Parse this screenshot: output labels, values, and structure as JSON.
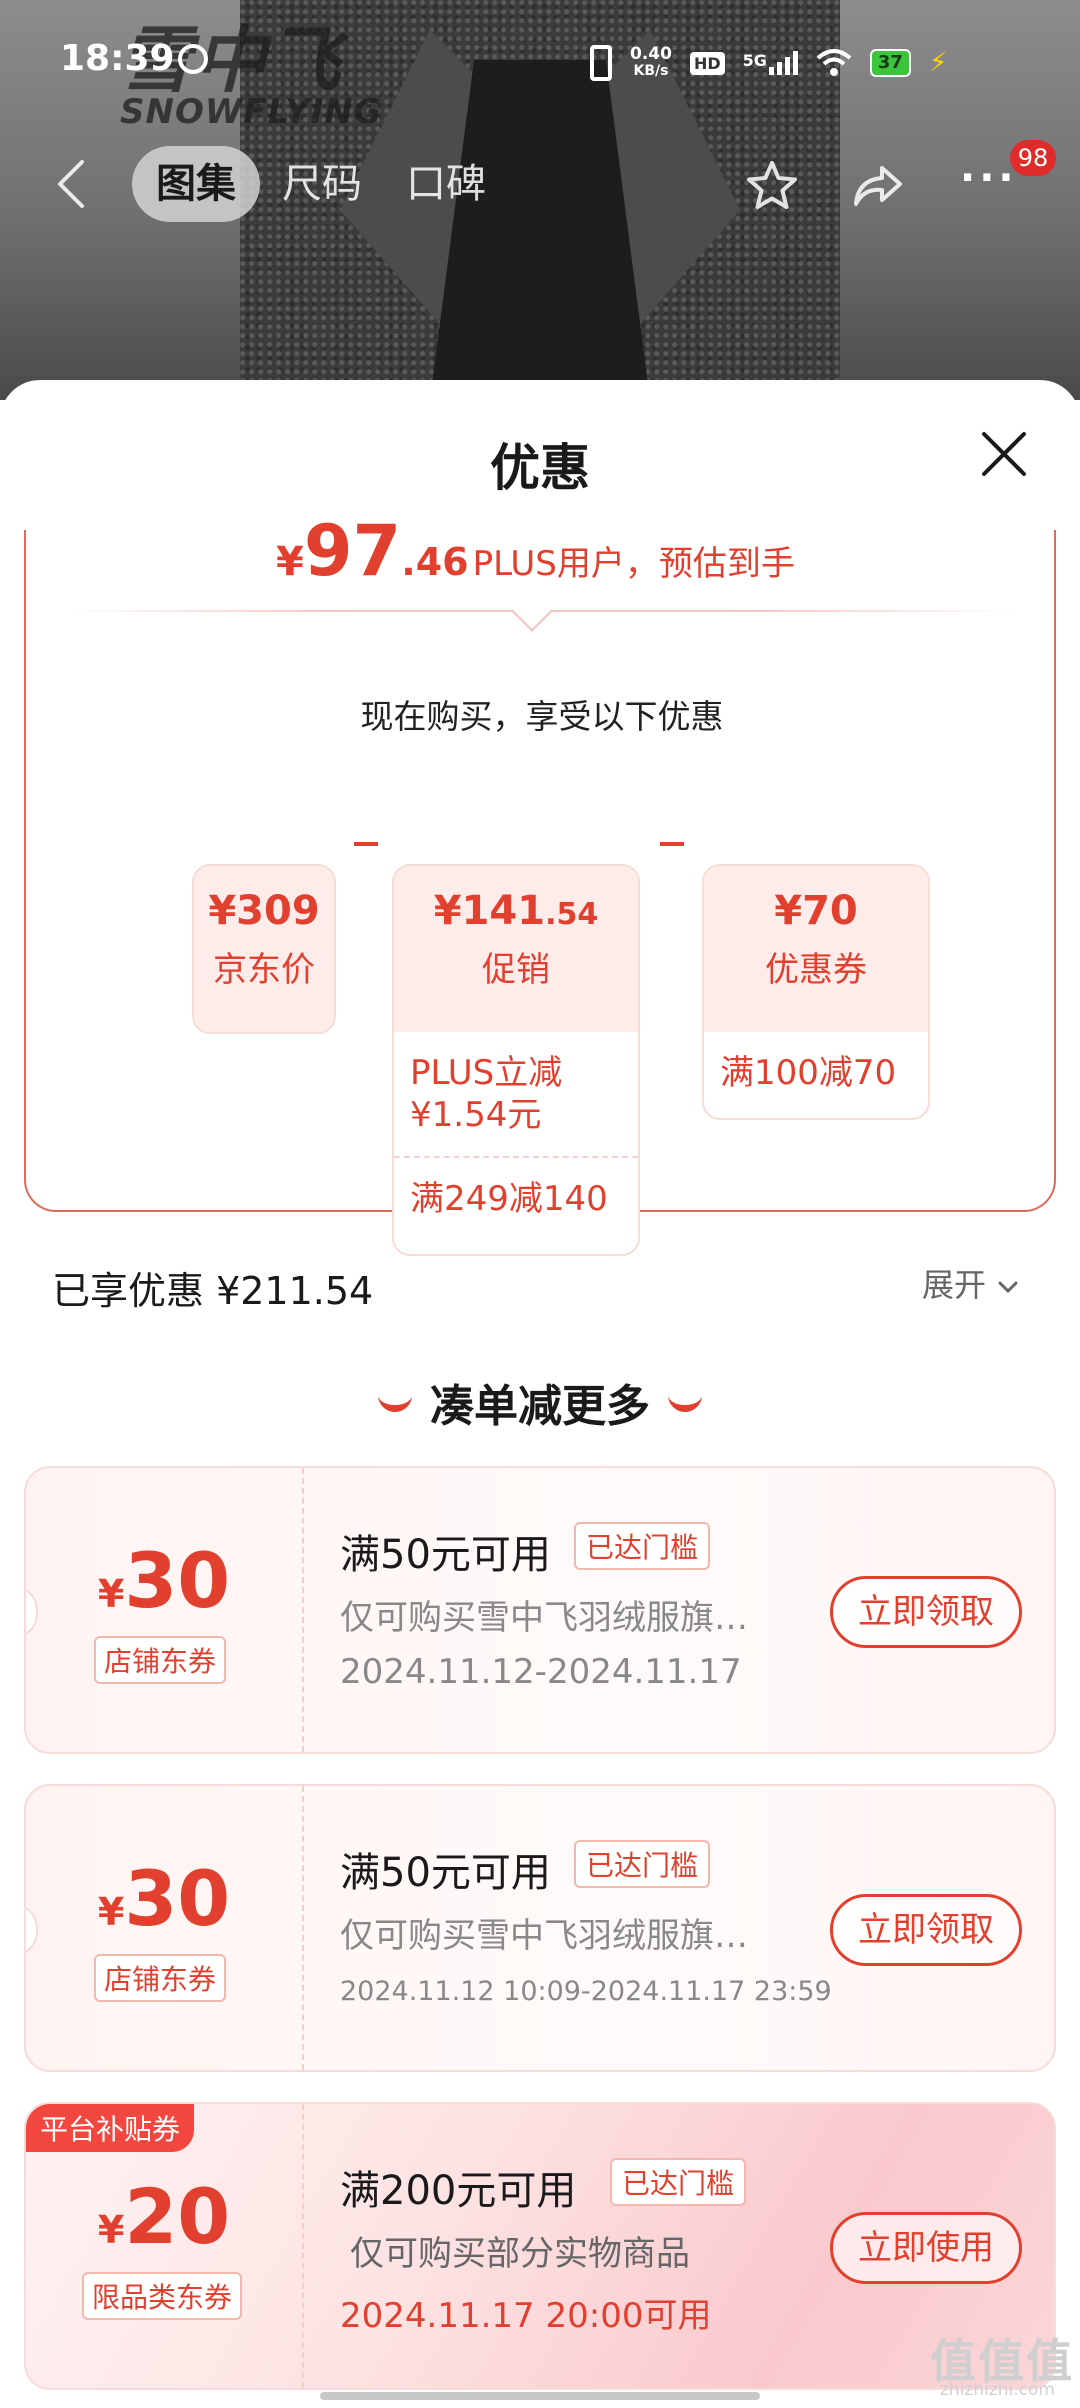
{
  "status_bar": {
    "time": "18:39",
    "net_speed_value": "0.40",
    "net_speed_unit": "KB/s",
    "hd": "HD",
    "network": "5G",
    "battery": "37"
  },
  "brand": {
    "cn": "雪中飞",
    "en": "SNOWFLYING"
  },
  "nav": {
    "tabs": [
      "图集",
      "尺码",
      "口碑"
    ],
    "active_tab": "图集",
    "more_badge": "98"
  },
  "sheet": {
    "title": "优惠",
    "estimate": {
      "symbol": "¥",
      "integer": "97",
      "decimal": ".46",
      "text": "PLUS用户，预估到手"
    },
    "now_buy": "现在购买，享受以下优惠",
    "boxes": [
      {
        "symbol": "¥",
        "amount": "309",
        "amount_small": "",
        "label": "京东价",
        "rows": []
      },
      {
        "symbol": "¥",
        "amount": "141",
        "amount_small": ".54",
        "label": "促销",
        "rows": [
          "PLUS立减\n¥1.54元",
          "满249减140"
        ]
      },
      {
        "symbol": "¥",
        "amount": "70",
        "amount_small": "",
        "label": "优惠券",
        "rows": [
          "满100减70"
        ]
      }
    ],
    "row_plus_line1": "PLUS立减",
    "row_plus_line2": "¥1.54元",
    "row_249": "满249减140",
    "row_100": "满100减70",
    "enjoyed": "已享优惠 ¥211.54",
    "expand": "展开",
    "more_heading": "凑单减更多"
  },
  "coupons": [
    {
      "symbol": "¥",
      "amount": "30",
      "type": "店铺东券",
      "title": "满50元可用",
      "tag": "已达门槛",
      "desc": "仅可购买雪中飞羽绒服旗…",
      "date": "2024.11.12-2024.11.17",
      "button": "立即领取"
    },
    {
      "symbol": "¥",
      "amount": "30",
      "type": "店铺东券",
      "title": "满50元可用",
      "tag": "已达门槛",
      "desc": "仅可购买雪中飞羽绒服旗…",
      "date": "2024.11.12 10:09-2024.11.17 23:59",
      "button": "立即领取"
    },
    {
      "platform_tag": "平台补贴券",
      "symbol": "¥",
      "amount": "20",
      "type": "限品类东券",
      "title": "满200元可用",
      "tag": "已达门槛",
      "desc": "仅可购买部分实物商品",
      "date": "2024.11.17 20:00可用",
      "button": "立即使用"
    }
  ],
  "watermark": {
    "main": "值值值",
    "sub": "zhizhizhi.com"
  },
  "colors": {
    "accent": "#e0402d",
    "badge": "#e02b2b",
    "platform_tag": "#f2473f"
  }
}
